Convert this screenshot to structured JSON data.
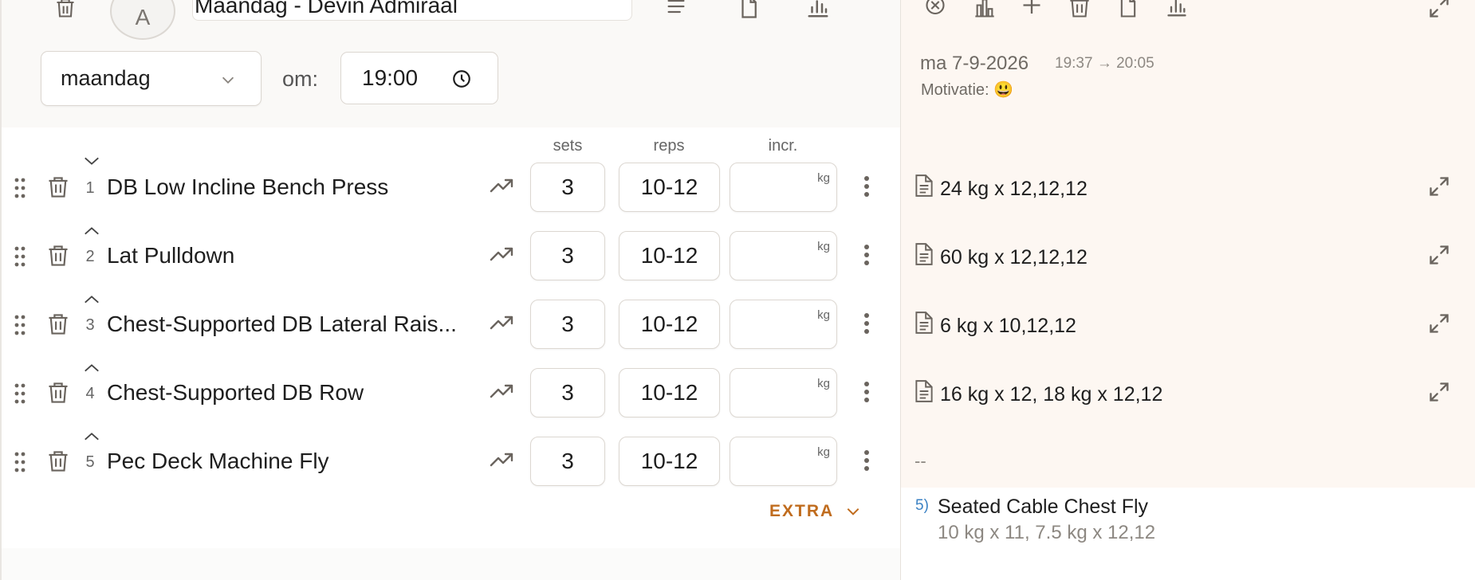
{
  "header": {
    "avatar_letter": "A",
    "title": "Maandag - Devin Admiraal",
    "day": "maandag",
    "time_label": "om:",
    "time": "19:00"
  },
  "columns": {
    "sets": "sets",
    "reps": "reps",
    "incr": "incr.",
    "unit": "kg"
  },
  "exercises": [
    {
      "num": "1",
      "name": "DB Low Incline Bench Press",
      "sets": "3",
      "reps": "10-12",
      "incr": "",
      "log": "24 kg x 12,12,12"
    },
    {
      "num": "2",
      "name": "Lat Pulldown",
      "sets": "3",
      "reps": "10-12",
      "incr": "",
      "log": "60 kg x 12,12,12"
    },
    {
      "num": "3",
      "name": "Chest-Supported DB Lateral Rais...",
      "sets": "3",
      "reps": "10-12",
      "incr": "",
      "log": "6 kg x 10,12,12"
    },
    {
      "num": "4",
      "name": "Chest-Supported DB Row",
      "sets": "3",
      "reps": "10-12",
      "incr": "",
      "log": "16 kg x 12, 18 kg x 12,12"
    },
    {
      "num": "5",
      "name": "Pec Deck Machine Fly",
      "sets": "3",
      "reps": "10-12",
      "incr": "",
      "log": "--"
    }
  ],
  "extra_button": "EXTRA",
  "session": {
    "date": "ma 7-9-2026",
    "time_range": "19:37 → 20:05",
    "motivation_label": "Motivatie:",
    "motivation_emoji": "😃"
  },
  "extra_exercise": {
    "num": "5)",
    "name": "Seated Cable Chest Fly",
    "detail": "10 kg x 11, 7.5 kg x 12,12"
  },
  "icons": {
    "left_toolbar": [
      "trash-icon",
      "list-icon",
      "document-icon",
      "bar-chart-icon"
    ],
    "right_toolbar": [
      "close-circle-icon",
      "statistics-icon",
      "plus-icon",
      "trash-icon",
      "document-icon",
      "bar-chart-icon",
      "expand-icon"
    ]
  },
  "colors": {
    "accent": "#c06c1e",
    "link": "#3b82c4",
    "panel_right": "#fdf7f2"
  }
}
